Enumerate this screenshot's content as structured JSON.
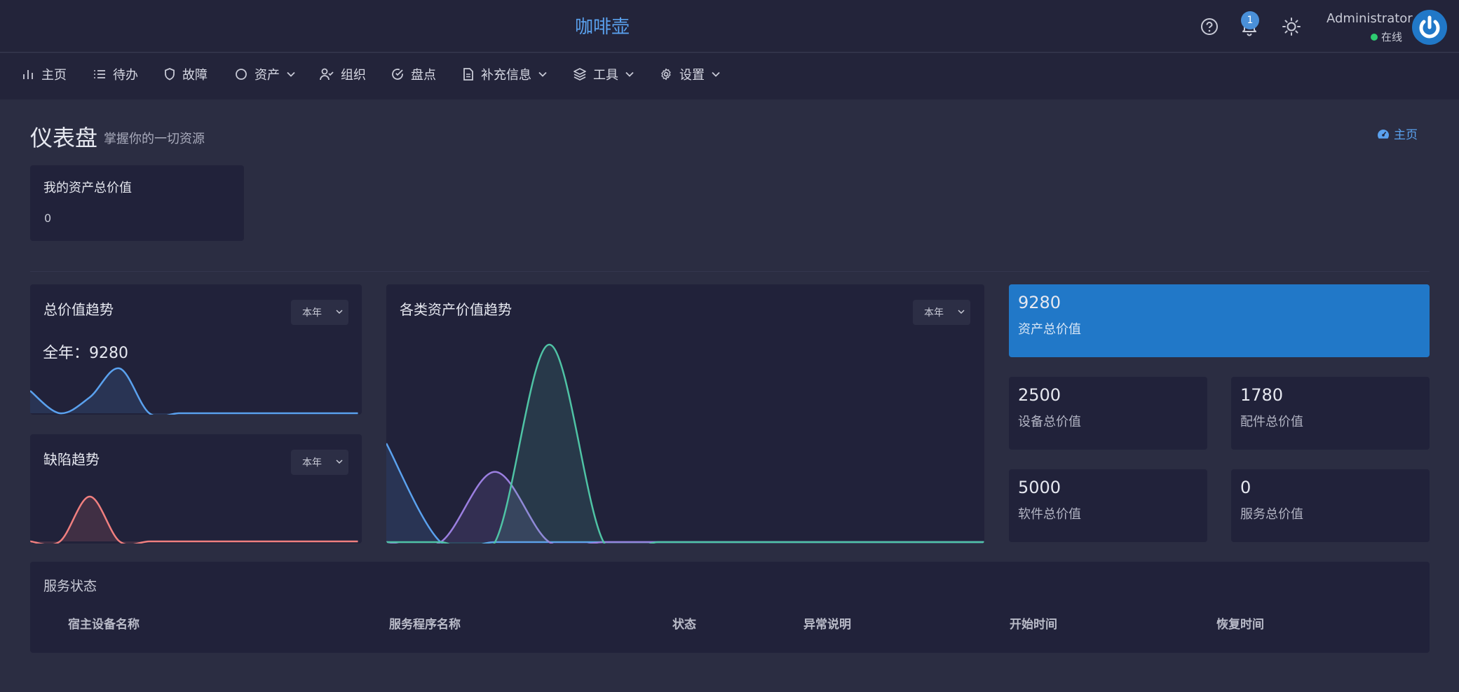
{
  "header": {
    "app_title": "咖啡壶",
    "notification_count": "1",
    "user_name": "Administrator",
    "user_status": "在线"
  },
  "nav": [
    {
      "label": "主页",
      "icon": "bar-chart-icon"
    },
    {
      "label": "待办",
      "icon": "list-icon"
    },
    {
      "label": "故障",
      "icon": "shield-icon"
    },
    {
      "label": "资产",
      "icon": "circle-icon"
    },
    {
      "label": "组织",
      "icon": "user-check-icon"
    },
    {
      "label": "盘点",
      "icon": "check-circle-icon"
    },
    {
      "label": "补充信息",
      "icon": "file-icon"
    },
    {
      "label": "工具",
      "icon": "layers-icon"
    },
    {
      "label": "设置",
      "icon": "gear-icon"
    }
  ],
  "page": {
    "title": "仪表盘",
    "subtitle": "掌握你的一切资源",
    "breadcrumb": "主页"
  },
  "my_assets": {
    "title": "我的资产总价值",
    "value": "0"
  },
  "total_value_trend": {
    "title": "总价值趋势",
    "select": "本年",
    "summary": "全年：9280"
  },
  "defect_trend": {
    "title": "缺陷趋势",
    "select": "本年"
  },
  "category_trend": {
    "title": "各类资产价值趋势",
    "select": "本年"
  },
  "stats": {
    "total": {
      "value": "9280",
      "label": "资产总价值"
    },
    "device": {
      "value": "2500",
      "label": "设备总价值"
    },
    "parts": {
      "value": "1780",
      "label": "配件总价值"
    },
    "software": {
      "value": "5000",
      "label": "软件总价值"
    },
    "service": {
      "value": "0",
      "label": "服务总价值"
    }
  },
  "service_status": {
    "title": "服务状态",
    "columns": [
      "宿主设备名称",
      "服务程序名称",
      "状态",
      "异常说明",
      "开始时间",
      "恢复时间"
    ]
  },
  "colors": {
    "accent": "#2178c8",
    "link": "#5aa1ee",
    "blue_series": "#5aa1ee",
    "purple_series": "#9b7fe0",
    "teal_series": "#4fc3a5",
    "red_series": "#f07f7f"
  },
  "chart_data": [
    {
      "type": "area",
      "title": "总价值趋势",
      "x": [
        1,
        2,
        3,
        4,
        5,
        6,
        7,
        8,
        9,
        10,
        11,
        12
      ],
      "series": [
        {
          "values": [
            2500,
            0,
            1780,
            5000,
            0,
            0,
            0,
            0,
            0,
            0,
            0,
            0
          ]
        }
      ]
    },
    {
      "type": "area",
      "title": "缺陷趋势",
      "x": [
        1,
        2,
        3,
        4,
        5,
        6,
        7,
        8,
        9,
        10,
        11,
        12
      ],
      "series": [
        {
          "values": [
            0,
            0,
            1,
            0,
            0,
            0,
            0,
            0,
            0,
            0,
            0,
            0
          ]
        }
      ]
    },
    {
      "type": "area",
      "title": "各类资产价值趋势",
      "x": [
        1,
        2,
        3,
        4,
        5,
        6,
        7,
        8,
        9,
        10,
        11,
        12
      ],
      "series": [
        {
          "values": [
            2500,
            0,
            0,
            0,
            0,
            0,
            0,
            0,
            0,
            0,
            0,
            0
          ]
        },
        {
          "values": [
            0,
            0,
            1780,
            0,
            0,
            0,
            0,
            0,
            0,
            0,
            0,
            0
          ]
        },
        {
          "values": [
            0,
            0,
            0,
            5000,
            0,
            0,
            0,
            0,
            0,
            0,
            0,
            0
          ]
        }
      ]
    }
  ]
}
